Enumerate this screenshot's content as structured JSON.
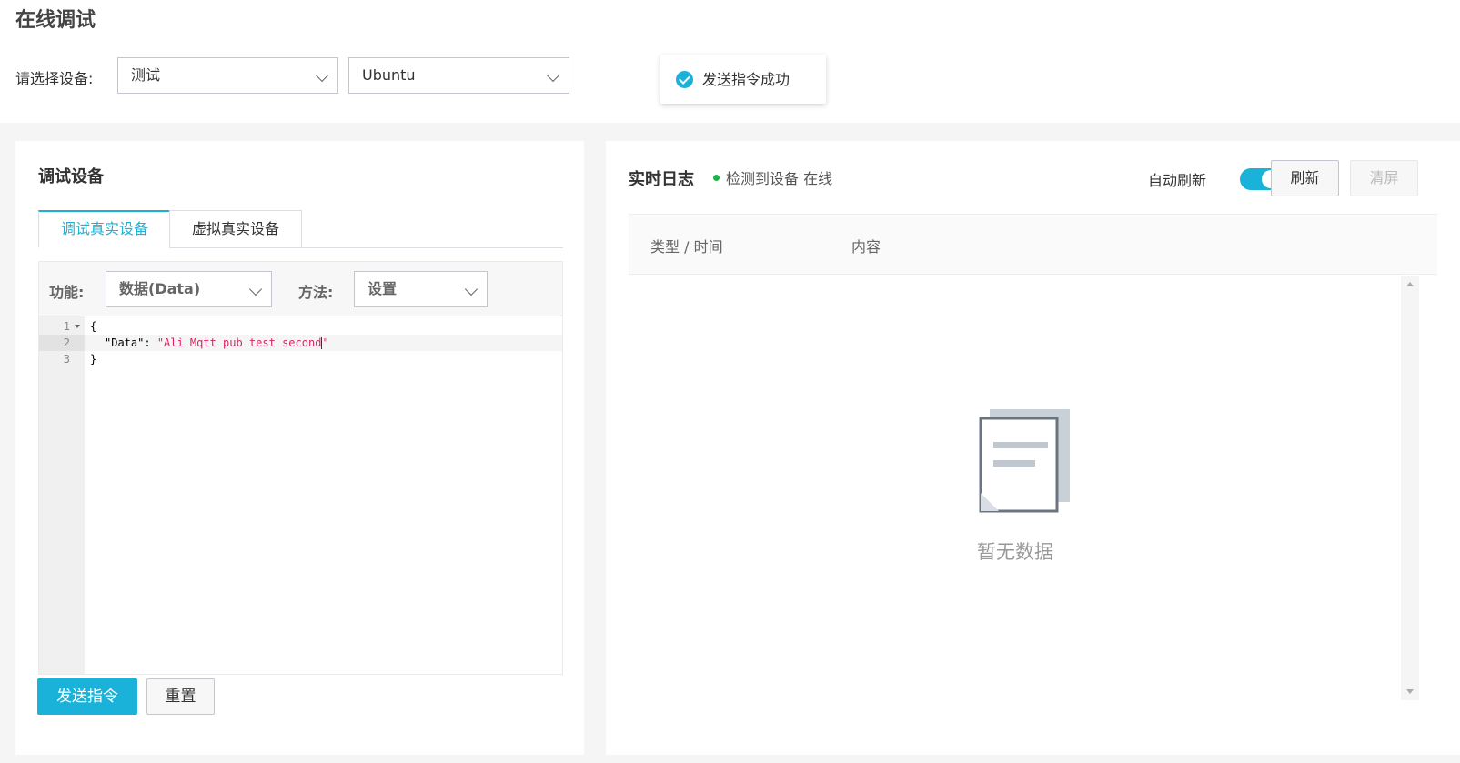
{
  "header": {
    "title": "在线调试",
    "device_label": "请选择设备:",
    "product_select": "测试",
    "device_select": "Ubuntu"
  },
  "toast": {
    "message": "发送指令成功"
  },
  "left_panel": {
    "title": "调试设备",
    "tabs": [
      {
        "label": "调试真实设备",
        "active": true
      },
      {
        "label": "虚拟真实设备",
        "active": false
      }
    ],
    "function_label": "功能:",
    "function_value": "数据(Data)",
    "method_label": "方法:",
    "method_value": "设置",
    "editor": {
      "lines": [
        {
          "num": "1",
          "text": "{"
        },
        {
          "num": "2",
          "key": "\"Data\"",
          "sep": ": ",
          "value": "\"Ali Mqtt pub test second\""
        },
        {
          "num": "3",
          "text": "}"
        }
      ]
    },
    "send_button": "发送指令",
    "reset_button": "重置"
  },
  "right_panel": {
    "title": "实时日志",
    "status_text": "检测到设备 在线",
    "status_color": "#1db249",
    "auto_refresh_label": "自动刷新",
    "auto_refresh_on": true,
    "refresh_button": "刷新",
    "clear_button": "清屏",
    "columns": [
      "类型 / 时间",
      "内容"
    ],
    "empty_text": "暂无数据",
    "empty_icon": "empty-document-icon"
  },
  "colors": {
    "accent": "#1ab2d8",
    "error_string": "#d6265e"
  }
}
